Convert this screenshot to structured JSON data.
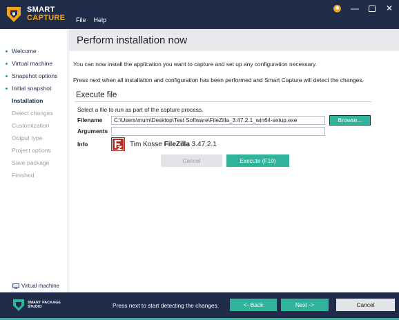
{
  "app": {
    "logo_line1": "SMART",
    "logo_line2": "CAPTURE",
    "menu": [
      "File",
      "Help"
    ]
  },
  "sidebar": {
    "steps": [
      {
        "label": "Welcome",
        "state": "done"
      },
      {
        "label": "Virtual machine",
        "state": "done"
      },
      {
        "label": "Snapshot options",
        "state": "done"
      },
      {
        "label": "Initial snapshot",
        "state": "done"
      },
      {
        "label": "Installation",
        "state": "current"
      },
      {
        "label": "Detect changes",
        "state": "pending"
      },
      {
        "label": "Customization",
        "state": "pending"
      },
      {
        "label": "Output type",
        "state": "pending"
      },
      {
        "label": "Project options",
        "state": "pending"
      },
      {
        "label": "Save package",
        "state": "pending"
      },
      {
        "label": "Finished",
        "state": "pending"
      }
    ],
    "footer_label": "Virtual machine",
    "footer_icon": "virtual-machine-icon"
  },
  "page": {
    "title": "Perform installation now",
    "intro1": "You can now install the application you want to capture and set up any configuration necessary.",
    "intro2": "Press next when all installation and configuration has been performed and Smart Capture will detect the changes."
  },
  "execute": {
    "section_title": "Execute file",
    "hint": "Select a file to run as part of the capture process.",
    "filename_label": "Filename",
    "filename_value": "C:\\Users\\mum\\Desktop\\Test Software\\FileZilla_3.47.2.1_win64-setup.exe",
    "arguments_label": "Arguments",
    "arguments_value": "",
    "browse_label": "Browse...",
    "info_label": "Info",
    "info_vendor": "Tim Kosse",
    "info_product": "FileZilla",
    "info_version": "3.47.2.1",
    "cancel_label": "Cancel",
    "execute_label": "Execute (F10)"
  },
  "footer": {
    "brand_line1": "SMART PACKAGE",
    "brand_line2": "STUDIO",
    "status_text": "Press next to start detecting the changes.",
    "back_label": "<- Back",
    "next_label": "Next ->",
    "cancel_label": "Cancel"
  },
  "colors": {
    "navy": "#1f2d4a",
    "teal": "#2fb39b",
    "orange": "#f2a31b",
    "filezilla_red": "#b5261e"
  }
}
